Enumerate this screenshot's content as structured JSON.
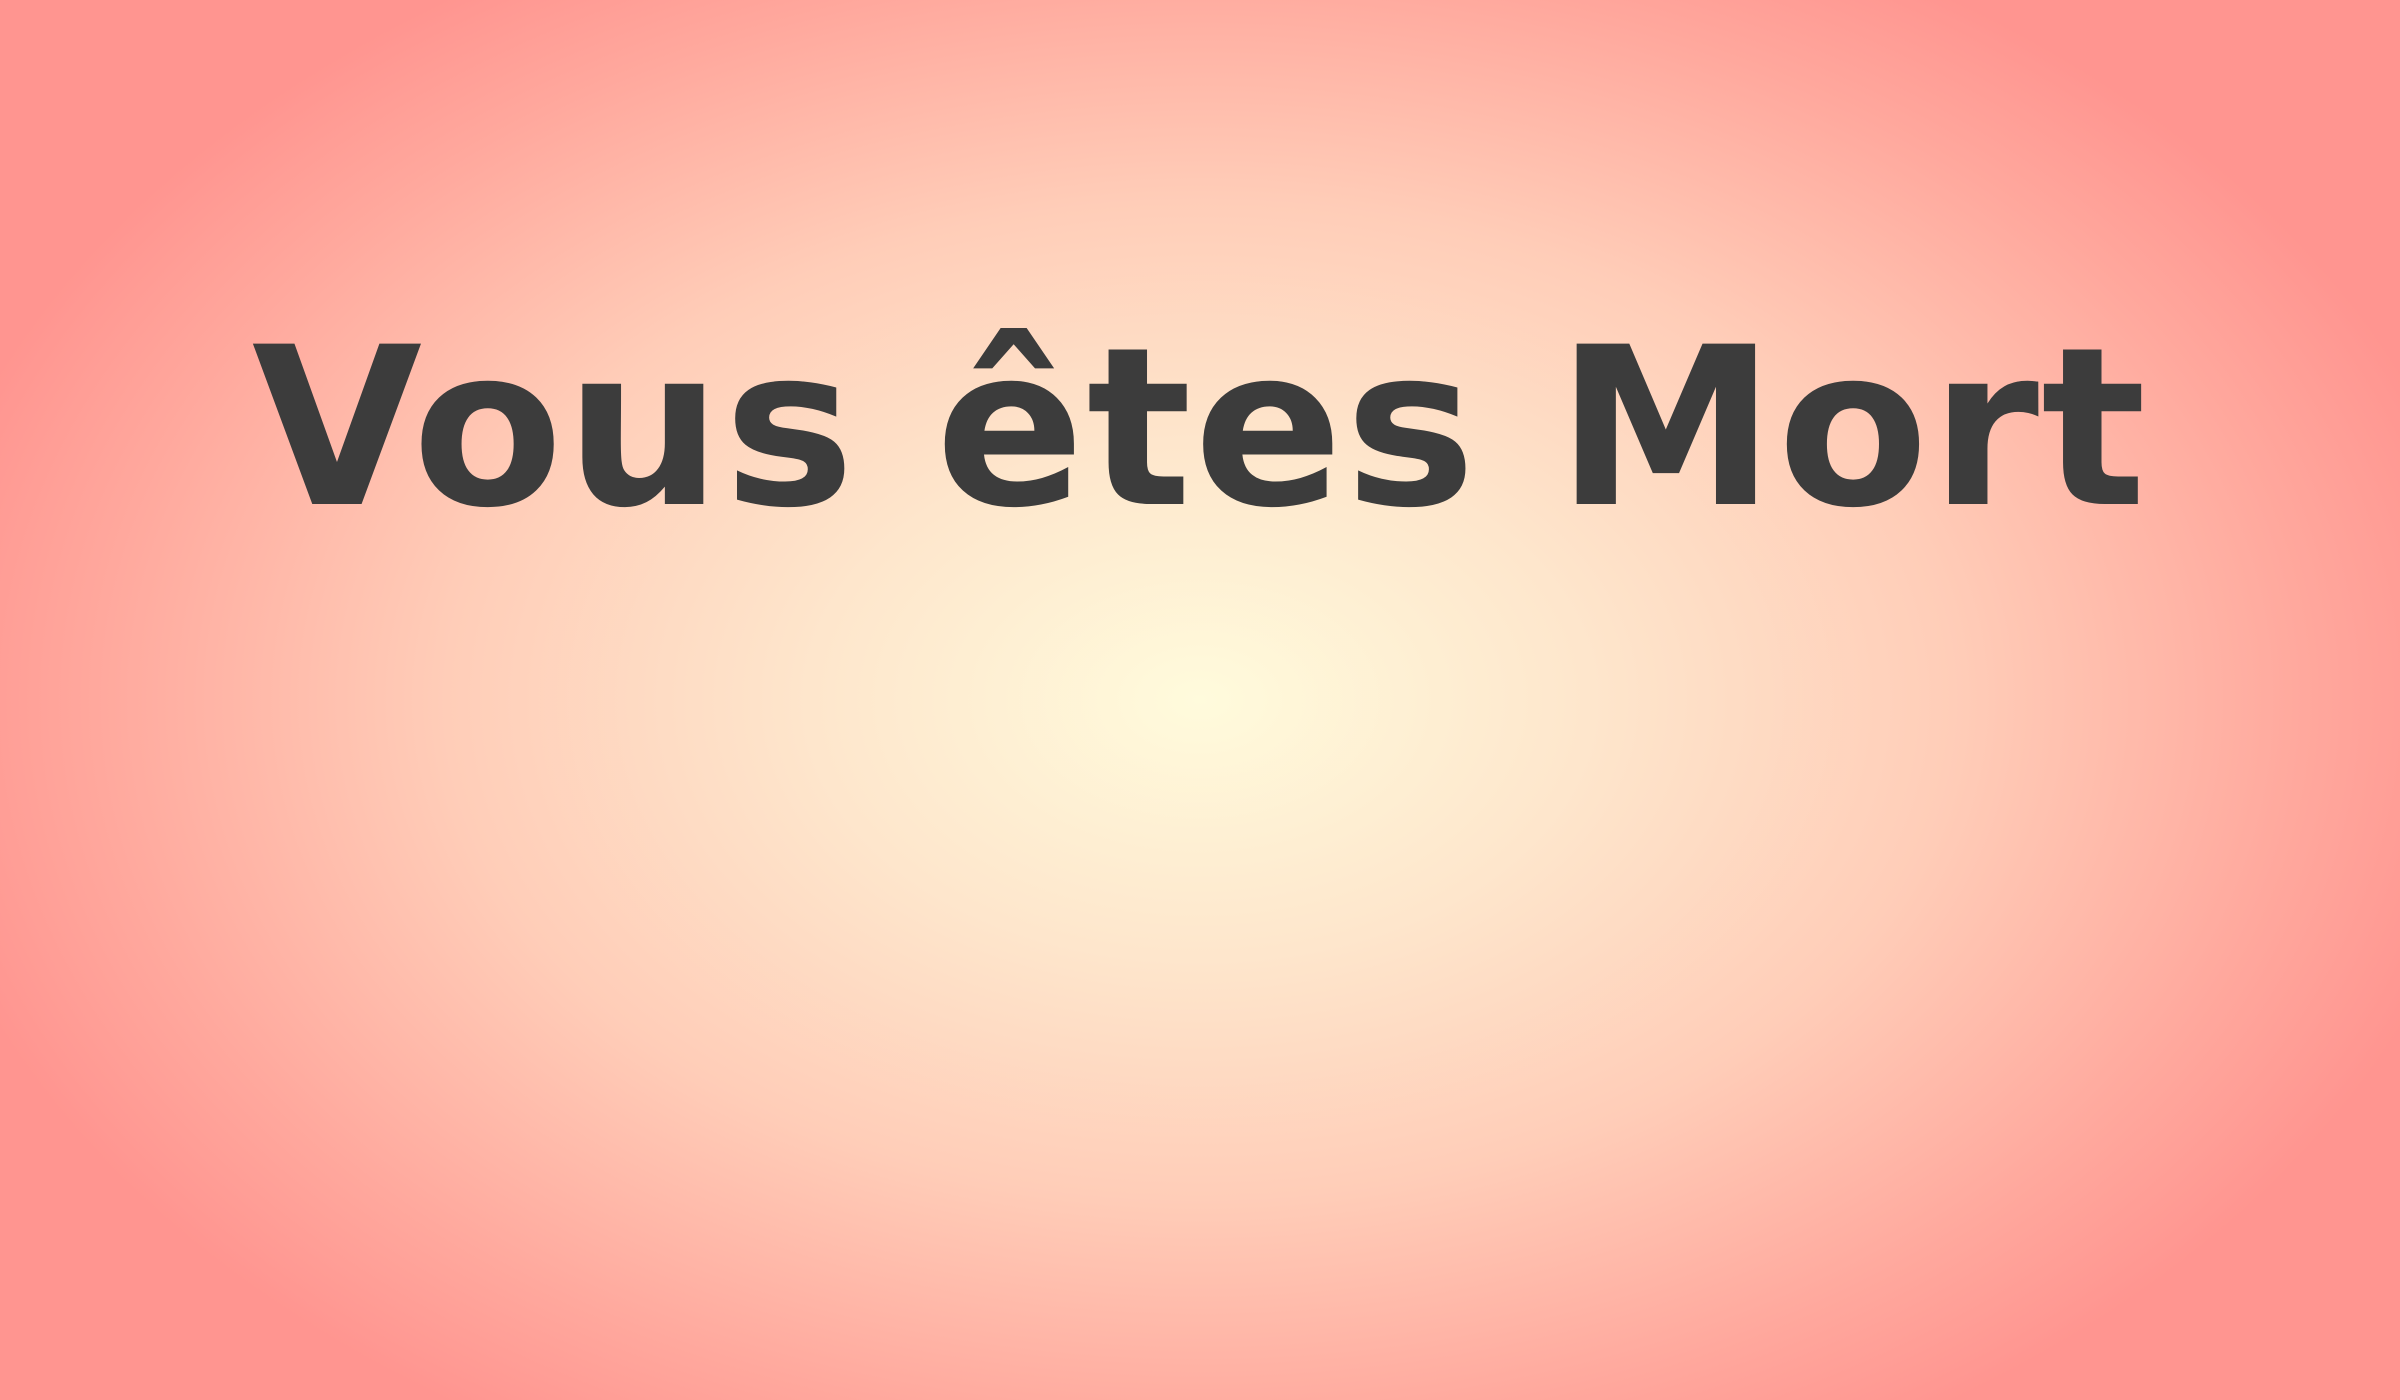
{
  "death_screen": {
    "title": "Vous êtes Mort",
    "text_color": "#3c3c3c",
    "background_center_color": "#fffbdc",
    "background_edge_color": "#ff9590"
  }
}
